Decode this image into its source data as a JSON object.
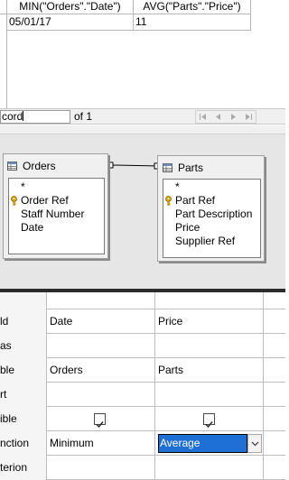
{
  "results": {
    "columns": [
      "MIN(\"Orders\".\"Date\")",
      "AVG(\"Parts\".\"Price\")"
    ],
    "rows": [
      [
        "05/01/17",
        "11"
      ]
    ]
  },
  "navigation": {
    "record_label": "cord",
    "of_text": "of 1"
  },
  "tables": [
    {
      "name": "Orders",
      "fields": [
        {
          "label": "*",
          "key": false
        },
        {
          "label": "Order Ref",
          "key": true
        },
        {
          "label": "Staff Number",
          "key": false
        },
        {
          "label": "Date",
          "key": false
        }
      ]
    },
    {
      "name": "Parts",
      "fields": [
        {
          "label": "*",
          "key": false
        },
        {
          "label": "Part Ref",
          "key": true
        },
        {
          "label": "Part Description",
          "key": false
        },
        {
          "label": "Price",
          "key": false
        },
        {
          "label": "Supplier Ref",
          "key": false
        }
      ]
    }
  ],
  "criteria": {
    "row_labels": [
      "ld",
      "as",
      "ble",
      "rt",
      "ible",
      "nction",
      "terion"
    ],
    "columns": [
      {
        "field": "Date",
        "table": "Orders",
        "visible": true,
        "function": "Minimum"
      },
      {
        "field": "Price",
        "table": "Parts",
        "visible": true,
        "function": "Average"
      }
    ]
  },
  "colors": {
    "selection": "#1e6fd6",
    "key_icon": "#d9a300"
  },
  "icons": [
    "table-icon",
    "key-icon",
    "first-record-icon",
    "previous-record-icon",
    "next-record-icon",
    "last-record-icon",
    "checkmark-icon",
    "chevron-down-icon"
  ]
}
